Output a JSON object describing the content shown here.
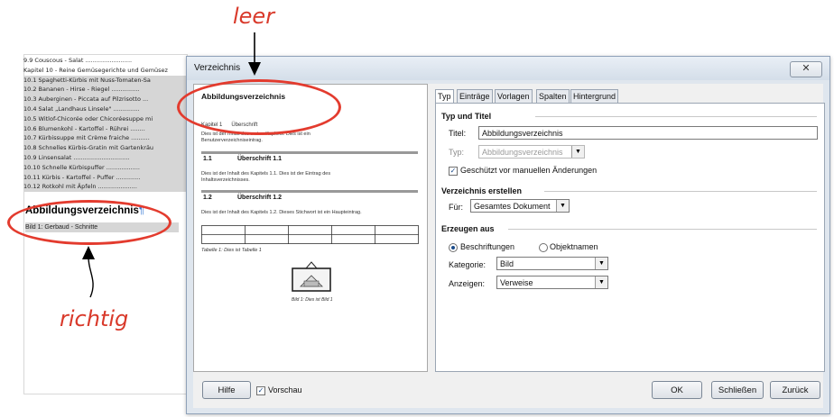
{
  "annotations": {
    "leer": "leer",
    "richtig": "richtig"
  },
  "background_doc": {
    "toc": [
      {
        "text": "9.9 Couscous - Salat .........................",
        "highlight": false
      },
      {
        "text": "Kapitel 10 - Reine Gemüsegerichte und Gemüsez",
        "highlight": false
      },
      {
        "text": "10.1 Spaghetti-Kürbis mit Nuss-Tomaten-Sa",
        "highlight": true
      },
      {
        "text": "10.2 Bananen - Hirse - Riegel ...............",
        "highlight": true
      },
      {
        "text": "10.3 Auberginen - Piccata auf Pilzrisotto ...",
        "highlight": true
      },
      {
        "text": "10.4 Salat „Landhaus Linsele\" ..............",
        "highlight": true
      },
      {
        "text": "10.5 Witlof-Chicorée oder Chicoréesuppe mi",
        "highlight": true
      },
      {
        "text": "10.6 Blumenkohl - Kartoffel - Rührei ........",
        "highlight": true
      },
      {
        "text": "10.7 Kürbissuppe mit Crème fraiche ..........",
        "highlight": true
      },
      {
        "text": "10.8 Schnelles Kürbis-Gratin mit Gartenkräu",
        "highlight": true
      },
      {
        "text": "10.9 Linsensalat ..............................",
        "highlight": true
      },
      {
        "text": "10.10 Schnelle Kürbispuffer ..................",
        "highlight": true
      },
      {
        "text": "10.11 Kürbis - Kartoffel - Puffer .............",
        "highlight": true
      },
      {
        "text": "10.12 Rotkohl mit Äpfeln .....................",
        "highlight": true
      }
    ],
    "heading": "Abbildungsverzeichnis",
    "pilcrow": "¶",
    "bild_entry": "Bild 1: Gerbaud - Schnitte"
  },
  "dialog": {
    "title": "Verzeichnis",
    "close_glyph": "✕",
    "preview": {
      "title": "Abbildungsverzeichnis",
      "kapitel_a": "Kapitel 1",
      "kapitel_b": "Überschrift",
      "text1": "Dies ist der Inhalt des ersten Kapitels. Dies ist ein",
      "text1b": "Benutzerverzeichniseintrag.",
      "h11_num": "1.1",
      "h11": "Überschrift 1.1",
      "text2": "Dies ist der Inhalt des Kapitels 1.1. Dies ist der Eintrag des",
      "text2b": "Inhaltsverzeichnisses.",
      "h12_num": "1.2",
      "h12": "Überschrift 1.2",
      "text3": "Dies ist der Inhalt des Kapitels 1.2. Dieses Stichwort ist ein Haupteintrag.",
      "table_caption": "Tabelle 1: Dies ist Tabelle 1",
      "image_caption": "Bild 1: Dies ist Bild 1"
    },
    "tabs": [
      {
        "label": "Typ",
        "active": true
      },
      {
        "label": "Einträge",
        "active": false
      },
      {
        "label": "Vorlagen",
        "active": false
      },
      {
        "label": "Spalten",
        "active": false
      },
      {
        "label": "Hintergrund",
        "active": false
      }
    ],
    "typ_titel": {
      "section": "Typ und Titel",
      "titel_label": "Titel:",
      "titel_value": "Abbildungsverzeichnis",
      "typ_label": "Typ:",
      "typ_value": "Abbildungsverzeichnis",
      "geschuetzt_label": "Geschützt vor manuellen Änderungen",
      "geschuetzt_checked": true
    },
    "erstellen": {
      "section": "Verzeichnis erstellen",
      "fuer_label": "Für:",
      "fuer_value": "Gesamtes Dokument"
    },
    "erzeugen": {
      "section": "Erzeugen aus",
      "opt1": "Beschriftungen",
      "opt2": "Objektnamen",
      "selected": "Beschriftungen",
      "kategorie_label": "Kategorie:",
      "kategorie_value": "Bild",
      "anzeigen_label": "Anzeigen:",
      "anzeigen_value": "Verweise"
    },
    "footer": {
      "hilfe": "Hilfe",
      "vorschau": "Vorschau",
      "vorschau_checked": true,
      "ok": "OK",
      "schliessen": "Schließen",
      "zurueck": "Zurück"
    }
  },
  "colors": {
    "annotation": "#e33b2e",
    "annotation_text": "#d93a2b",
    "highlight": "#d6d6d6"
  }
}
